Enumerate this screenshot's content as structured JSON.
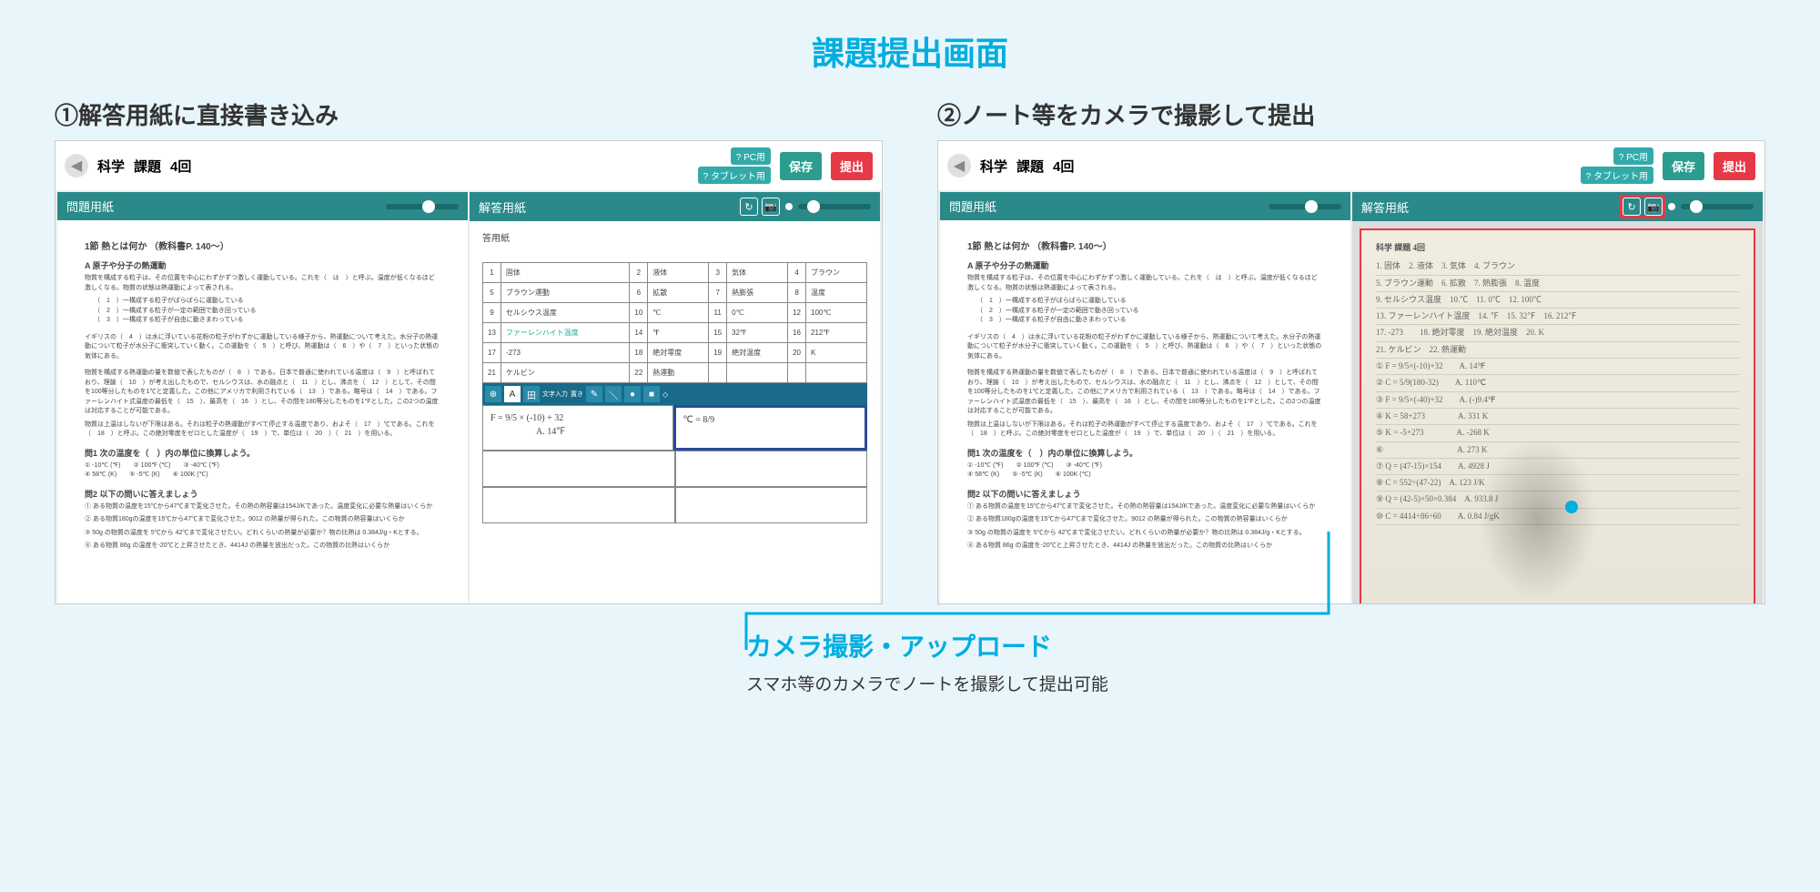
{
  "page": {
    "title": "課題提出画面",
    "panel1_title": "①解答用紙に直接書き込み",
    "panel2_title": "②ノート等をカメラで撮影して提出"
  },
  "header": {
    "subject": "科学",
    "label_assignment": "課題",
    "count": "4回",
    "pc_label": "? PC用",
    "tablet_label": "? タブレット用",
    "save": "保存",
    "submit": "提出"
  },
  "panes": {
    "question": "問題用紙",
    "answer": "解答用紙"
  },
  "question_doc": {
    "section": "1節 熱とは何か （教科書P. 140～）",
    "sub_a": "A 原子や分子の熱運動",
    "para1": "物質を構成する粒子は、その位置を中心にわずかずつ激しく運動している。これを（　は　）と呼ぶ。温度が低くなるほど激しくなる。物質の状態は熱運動によって表される。",
    "li1": "（　1　）一構成する粒子がばらばらに運動している",
    "li2": "（　2　）一構成する粒子が一定の範囲で動き回っている",
    "li3": "（　3　）一構成する粒子が自由に動きまわっている",
    "para2": "イギリスの（　4　）は水に浮いている花粉の粒子がわずかに運動している様子から、熱運動について考えた。水分子の熱運動について粒子が水分子に衝突していく動く。この運動を（　5　）と呼び、熱運動は（　6　）や（　7　）といった状態の気体にある。",
    "para3": "物質を構成する熱運動の量を数値で表したものが（　8　）である。日本で普通に使われている温度は（　9　）と呼ばれており、理論（　10　）が考え出したもので、セルシウスは、水の融点と（　11　）とし、沸点を（　12　）として、その間を100等分したものを1℃と定義した。この他にアメリカで利用されている（　13　）である。略号は（　14　）である。ファーレンハイト式温度の最低を（　15　）、最高を（　16　）とし、その間を180等分したものを1°Fとした。この2つの温度は対応することが可能である。",
    "para4": "物質は上温はしないが下限はある。それは粒子の熱運動がすべて停止する温度であり、およそ（　17　）℃である。これを（　18　）と呼ぶ。この絶対零度をゼロとした温度が（　19　）で、単位は（　20　）（　21　）を用いる。",
    "sub_b": "問1 次の温度を（　）内の単位に換算しよう。",
    "temps": "① -10℃ (℉)　　② 100℉ (℃)　　③ -40℃ (℉)\n④ 58℃ (K)　　⑤ -5℃ (K)　　⑥ 100K (℃)",
    "sub_c": "問2 以下の問いに答えましょう",
    "q1": "① ある物質の温度を15℃から47℃まで変化させた。その熱の熱容量は154J/Kであった。温度変化に必要な熱量はいくらか",
    "q2": "② ある物質180gの温度を15℃から47℃まで変化させた。9012 の熱量が得られた。この物質の熱容量はいくらか",
    "q3": "③ 50g の物質の温度を 5℃から 42℃まで変化させたい。どれくらいの熱量が必要か？物の比熱は 0.384J/g・Kとする。",
    "q4": "④ ある物質 86g の温度を-20℃と上昇させたとき、4414J の熱量を放出だった。この物質の比熱はいくらか"
  },
  "answer_sheet": {
    "heading": "答用紙",
    "rows": [
      [
        "1",
        "固体",
        "2",
        "液体",
        "3",
        "気体",
        "4",
        "ブラウン"
      ],
      [
        "5",
        "ブラウン運動",
        "6",
        "拡散",
        "7",
        "熱膨張",
        "8",
        "温度"
      ],
      [
        "9",
        "セルシウス温度",
        "10",
        "℃",
        "11",
        "0℃",
        "12",
        "100℃"
      ],
      [
        "13",
        "ファーレンハイト温度",
        "14",
        "℉",
        "15",
        "32℉",
        "16",
        "212℉"
      ],
      [
        "17",
        "-273",
        "18",
        "絶対零度",
        "19",
        "絶対温度",
        "20",
        "K"
      ],
      [
        "21",
        "ケルビン",
        "22",
        "熱運動",
        "",
        "",
        "",
        ""
      ]
    ],
    "formula1": "F = 9/5 × (-10) + 32\n　　　　　A. 14℉",
    "formula2": "℃ = 8/9",
    "toolbar_labels": [
      "⊕",
      "A",
      "田",
      "文字入力",
      "置き",
      "✎",
      "＼",
      "●",
      "■",
      "◇"
    ]
  },
  "handwritten": {
    "title": "科学 課題 4回",
    "lines": [
      "1. 固体　2. 液体　3. 気体　4. ブラウン",
      "5. ブラウン運動　6. 拡散　7. 熱膨張　8. 温度",
      "9. セルシウス温度　10.℃　11. 0℃　12. 100℃",
      "13. ファーレンハイト温度　14. ℉　15. 32℉　16. 212℉",
      "17. -273　　18. 絶対零度　19. 絶対温度　20. K",
      "21. ケルビン　22. 熱運動",
      "① F = 9/5×(-10)+32　　A. 14℉",
      "② C = 5/9(180-32)　　A. 110℃",
      "③ F = 9/5×(-40)+32　　A. (-)9.4℉",
      "④ K = 58+273　　　　A. 331 K",
      "⑤ K = -5+273　　　　A. -268 K",
      "⑥　　　　　　　　　A. 273 K",
      "⑦ Q = (47-15)×154　　A. 4928 J",
      "⑧ C = 552÷(47-22)　A. 123 J/K",
      "⑨ Q = (42-5)×50×0.384　A. 933.8 J",
      "⑩ C = 4414÷86÷60　　A. 0.84 J/gK"
    ]
  },
  "callout": {
    "title": "カメラ撮影・アップロード",
    "desc": "スマホ等のカメラでノートを撮影して提出可能"
  }
}
